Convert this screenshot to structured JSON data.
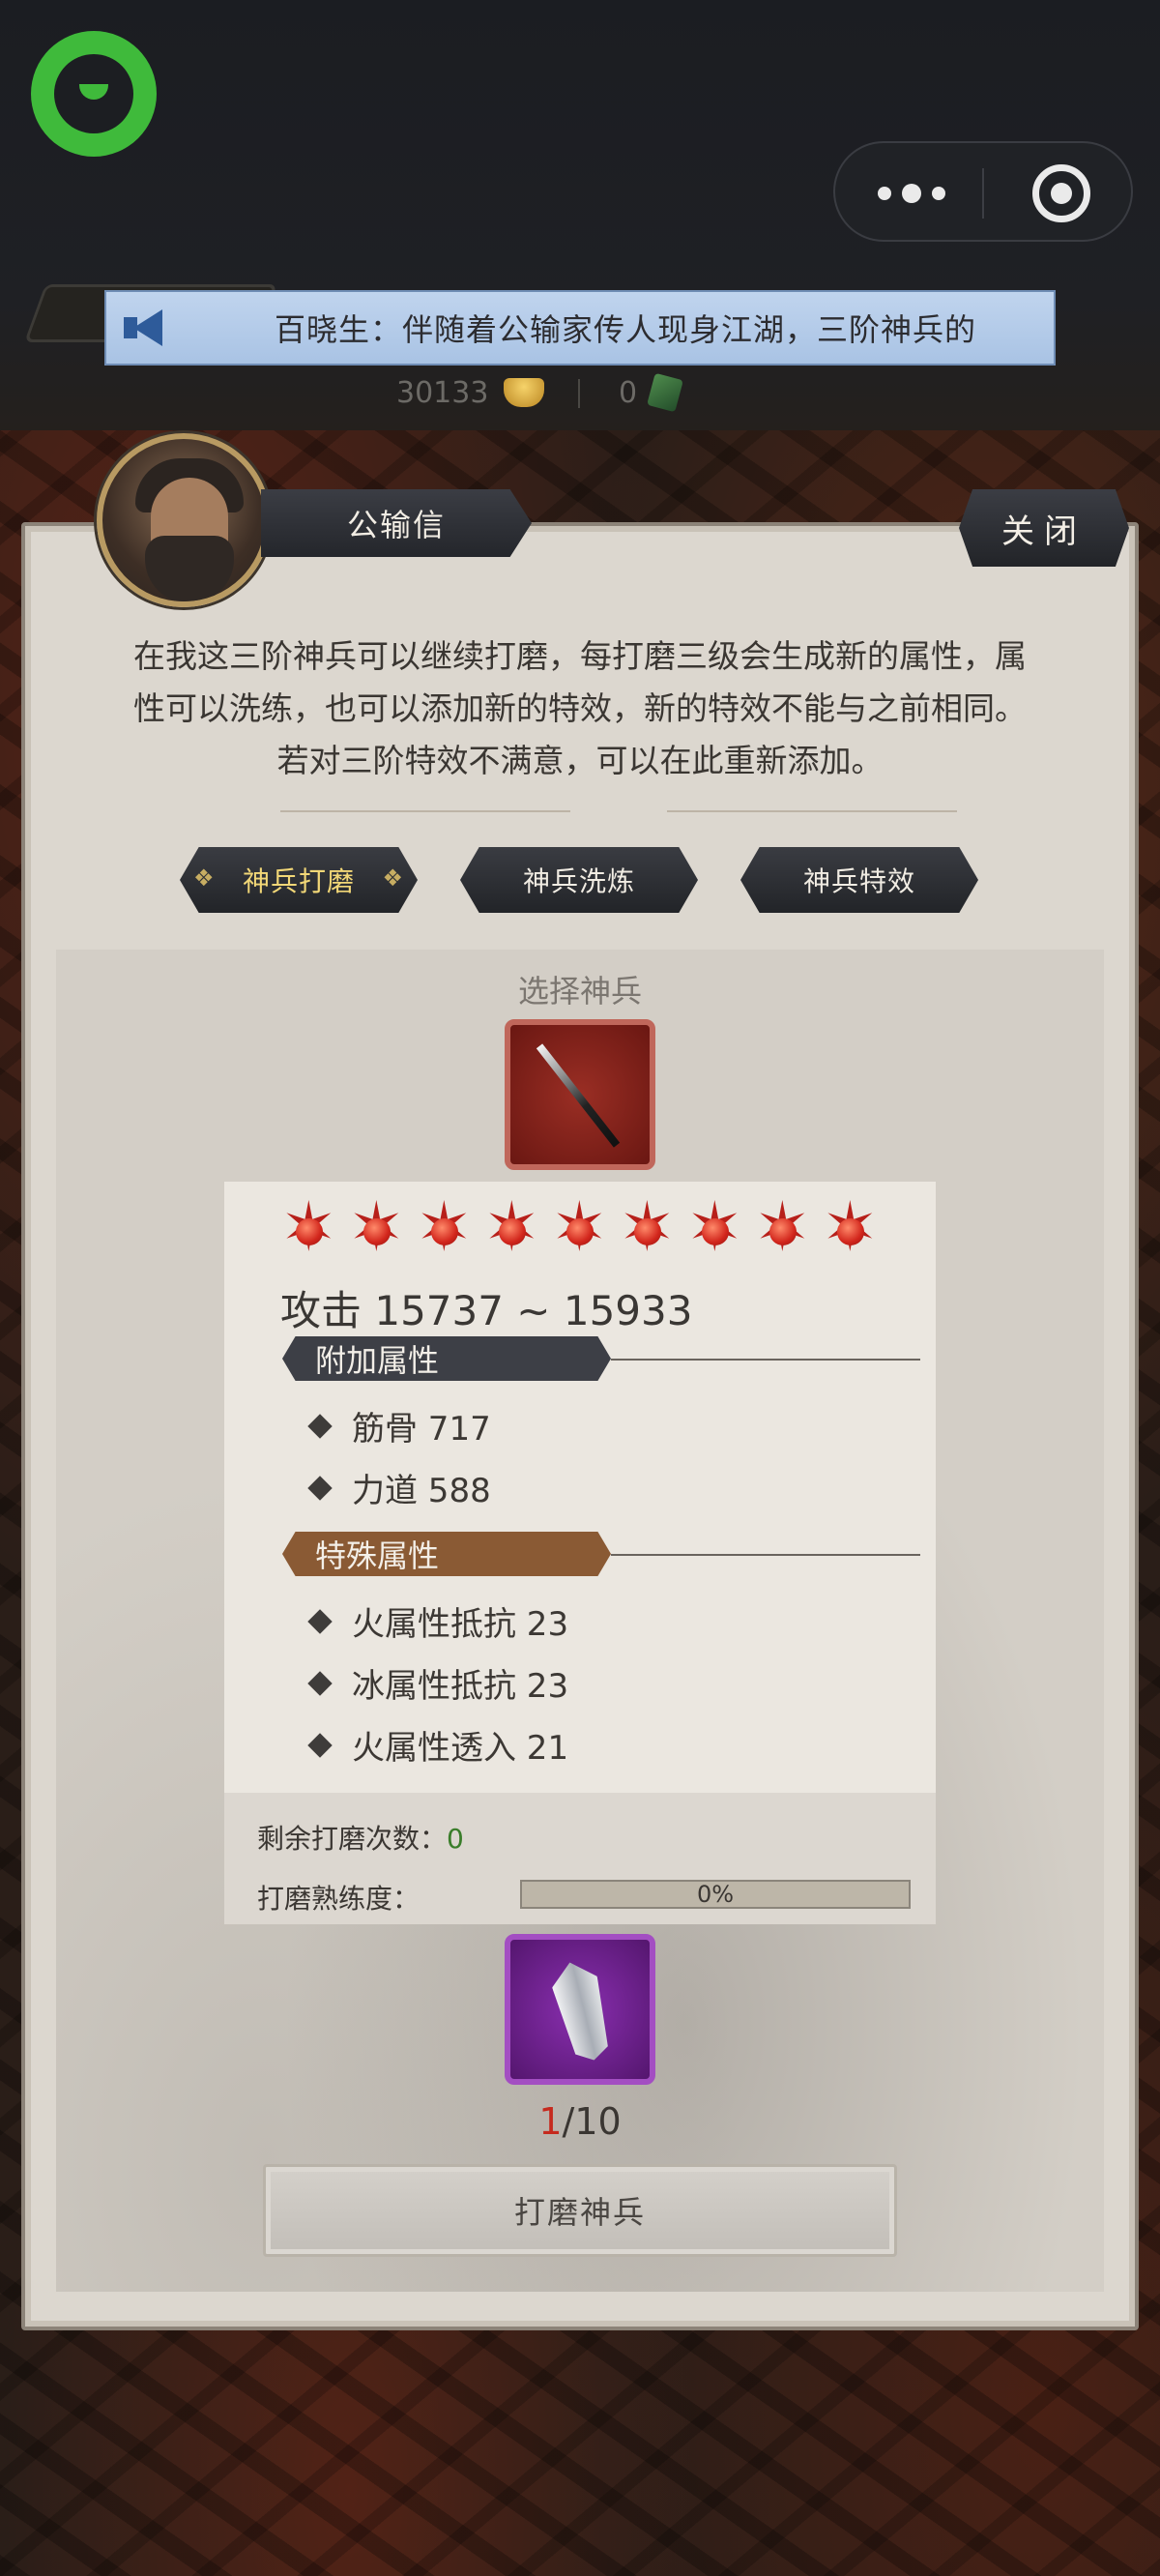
{
  "marquee": {
    "text": "百晓生：伴随着公输家传人现身江湖，三阶神兵的"
  },
  "currency": {
    "ingot": "30133",
    "jade": "0"
  },
  "npc": {
    "name": "公输信"
  },
  "close_label": "关闭",
  "intro": {
    "line1": "在我这三阶神兵可以继续打磨，每打磨三级会生成新的属性，属",
    "line2": "性可以洗练，也可以添加新的特效，新的特效不能与之前相同。",
    "line3": "若对三阶特效不满意，可以在此重新添加。"
  },
  "tabs": [
    {
      "label": "神兵打磨",
      "active": true
    },
    {
      "label": "神兵洗炼",
      "active": false
    },
    {
      "label": "神兵特效",
      "active": false
    }
  ],
  "select_label": "选择神兵",
  "weapon": {
    "stars": 9,
    "attack": "攻击  15737 ~ 15933",
    "extra_title": "附加属性",
    "extra_attrs": [
      "筋骨  717",
      "力道  588"
    ],
    "special_title": "特殊属性",
    "special_attrs": [
      "火属性抵抗 23",
      "冰属性抵抗 23",
      "火属性透入 21"
    ]
  },
  "remaining": {
    "label": "剩余打磨次数：",
    "value": "0"
  },
  "proficiency": {
    "label": "打磨熟练度：",
    "value": "0%",
    "fraction": 0
  },
  "material": {
    "have": "1",
    "need": "/10"
  },
  "polish_button": "打磨神兵",
  "colors": {
    "accent_gold": "#f2d777",
    "extra_head": "#3d3f46",
    "special_head": "#8a5a34",
    "count_red": "#c62a1e",
    "remaining_green": "#3a7d2a"
  }
}
